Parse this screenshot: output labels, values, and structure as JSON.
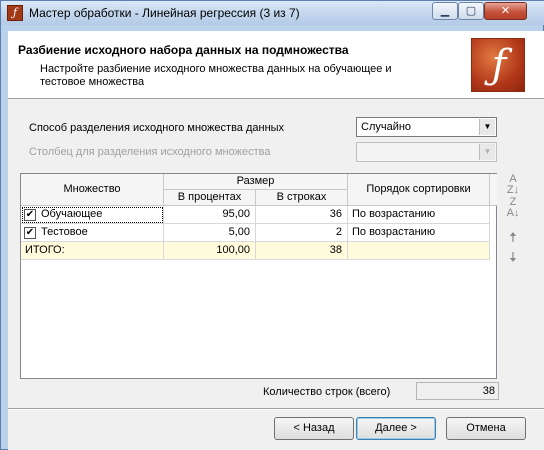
{
  "window": {
    "title": "Мастер обработки - Линейная регрессия (3 из 7)"
  },
  "header": {
    "title": "Разбиение исходного набора данных на подмножества",
    "subtitle": "Настройте разбиение исходного множества данных на обучающее и тестовое множества"
  },
  "split_method": {
    "label": "Способ разделения исходного множества данных",
    "value": "Случайно"
  },
  "split_column": {
    "label": "Столбец для разделения исходного множества",
    "value": ""
  },
  "grid": {
    "headers": {
      "set": "Множество",
      "size": "Размер",
      "percent": "В процентах",
      "rows": "В строках",
      "sort": "Порядок сортировки"
    },
    "rows": [
      {
        "checked": true,
        "name": "Обучающее",
        "percent": "95,00",
        "rows": "36",
        "sort": "По возрастанию"
      },
      {
        "checked": true,
        "name": "Тестовое",
        "percent": "5,00",
        "rows": "2",
        "sort": "По возрастанию"
      }
    ],
    "total": {
      "name": "ИТОГО:",
      "percent": "100,00",
      "rows": "38",
      "sort": ""
    }
  },
  "row_count": {
    "label": "Количество строк (всего)",
    "value": "38"
  },
  "buttons": {
    "back": "< Назад",
    "next": "Далее >",
    "cancel": "Отмена"
  },
  "icons": {
    "sort_asc": "sort-az-icon",
    "sort_desc": "sort-za-icon",
    "move_up": "arrow-up-icon",
    "move_down": "arrow-down-icon"
  }
}
